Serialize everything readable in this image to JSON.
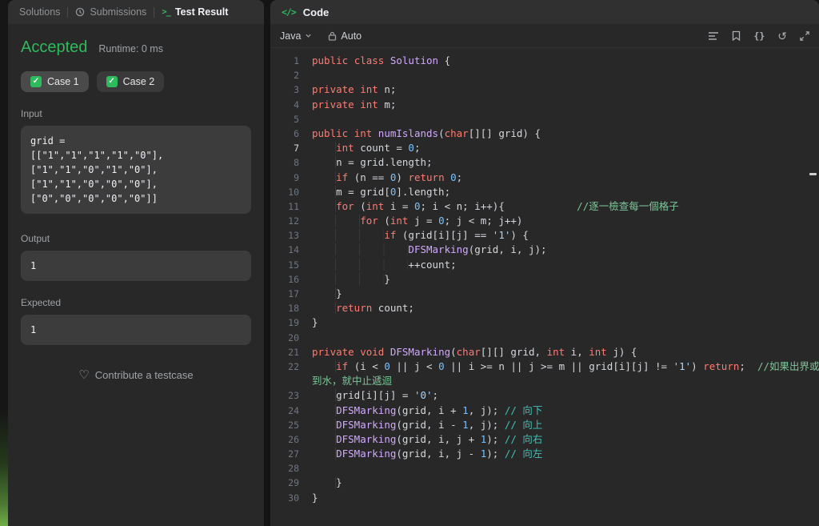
{
  "colors": {
    "accent_green": "#2cbb5d",
    "panel_bg": "#282828",
    "header_bg": "#303030",
    "box_bg": "#3c3c3c",
    "keyword": "#ff7b72",
    "function_name": "#d2a8ff",
    "number": "#79c0ff",
    "string": "#a5d6ff",
    "comment_green": "#7ec699",
    "comment_teal": "#43bfb4"
  },
  "icons": {
    "terminal": ">_",
    "code": "</>",
    "check": "✓",
    "heart": "♡",
    "undo": "↺",
    "braces": "{}"
  },
  "left_panel": {
    "tabs": [
      {
        "label": "Solutions"
      },
      {
        "label": "Submissions"
      },
      {
        "label": "Test Result"
      }
    ],
    "status": "Accepted",
    "runtime": "Runtime: 0 ms",
    "cases": [
      {
        "label": "Case 1"
      },
      {
        "label": "Case 2"
      }
    ],
    "input_label": "Input",
    "input_value": "grid =\n[[\"1\",\"1\",\"1\",\"1\",\"0\"],[\"1\",\"1\",\"0\",\"1\",\"0\"],[\"1\",\"1\",\"0\",\"0\",\"0\"],[\"0\",\"0\",\"0\",\"0\",\"0\"]]",
    "output_label": "Output",
    "output_value": "1",
    "expected_label": "Expected",
    "expected_value": "1",
    "contribute": "Contribute a testcase"
  },
  "editor": {
    "header_title": "Code",
    "language": "Java",
    "auto_label": "Auto",
    "toolbar_icons": [
      "format-icon",
      "bookmark-icon",
      "braces-icon",
      "undo-icon",
      "expand-icon"
    ],
    "lines": [
      {
        "n": "1",
        "tk": [
          [
            "public",
            "k"
          ],
          [
            " ",
            "d"
          ],
          [
            "class",
            "k"
          ],
          [
            " ",
            "d"
          ],
          [
            "Solution",
            "f"
          ],
          [
            " {",
            "d"
          ]
        ]
      },
      {
        "n": "2",
        "tk": []
      },
      {
        "n": "3",
        "tk": [
          [
            "private",
            "k"
          ],
          [
            " ",
            "d"
          ],
          [
            "int",
            "k"
          ],
          [
            " n;",
            "d"
          ]
        ]
      },
      {
        "n": "4",
        "tk": [
          [
            "private",
            "k"
          ],
          [
            " ",
            "d"
          ],
          [
            "int",
            "k"
          ],
          [
            " m;",
            "d"
          ]
        ]
      },
      {
        "n": "5",
        "tk": []
      },
      {
        "n": "6",
        "tk": [
          [
            "public",
            "k"
          ],
          [
            " ",
            "d"
          ],
          [
            "int",
            "k"
          ],
          [
            " ",
            "d"
          ],
          [
            "numIslands",
            "f"
          ],
          [
            "(",
            "d"
          ],
          [
            "char",
            "k"
          ],
          [
            "[][] grid) {",
            "d"
          ]
        ]
      },
      {
        "n": "7",
        "active": true,
        "tk": [
          [
            "    ",
            "i"
          ],
          [
            "int",
            "k"
          ],
          [
            " count = ",
            "d"
          ],
          [
            "0",
            "n"
          ],
          [
            ";",
            "d"
          ]
        ]
      },
      {
        "n": "8",
        "tk": [
          [
            "    ",
            "i"
          ],
          [
            "n = grid.length;",
            "d"
          ]
        ]
      },
      {
        "n": "9",
        "tk": [
          [
            "    ",
            "i"
          ],
          [
            "if",
            "k"
          ],
          [
            " (n == ",
            "d"
          ],
          [
            "0",
            "n"
          ],
          [
            ") ",
            "d"
          ],
          [
            "return",
            "k"
          ],
          [
            " ",
            "d"
          ],
          [
            "0",
            "n"
          ],
          [
            ";",
            "d"
          ]
        ]
      },
      {
        "n": "10",
        "tk": [
          [
            "    ",
            "i"
          ],
          [
            "m = grid[",
            "d"
          ],
          [
            "0",
            "n"
          ],
          [
            "].length;",
            "d"
          ]
        ]
      },
      {
        "n": "11",
        "tk": [
          [
            "    ",
            "i"
          ],
          [
            "for",
            "k"
          ],
          [
            " (",
            "d"
          ],
          [
            "int",
            "k"
          ],
          [
            " i = ",
            "d"
          ],
          [
            "0",
            "n"
          ],
          [
            "; i < n; i++){",
            "d"
          ],
          [
            "            ",
            "d"
          ],
          [
            "//逐一檢查每一個格子",
            "c"
          ]
        ]
      },
      {
        "n": "12",
        "tk": [
          [
            "        ",
            "i"
          ],
          [
            "for",
            "k"
          ],
          [
            " (",
            "d"
          ],
          [
            "int",
            "k"
          ],
          [
            " j = ",
            "d"
          ],
          [
            "0",
            "n"
          ],
          [
            "; j < m; j++)",
            "d"
          ]
        ]
      },
      {
        "n": "13",
        "tk": [
          [
            "            ",
            "i"
          ],
          [
            "if",
            "k"
          ],
          [
            " (grid[i][j] == ",
            "d"
          ],
          [
            "'1'",
            "s"
          ],
          [
            ") {",
            "d"
          ]
        ]
      },
      {
        "n": "14",
        "tk": [
          [
            "                ",
            "i"
          ],
          [
            "DFSMarking",
            "f"
          ],
          [
            "(grid, i, j);",
            "d"
          ]
        ]
      },
      {
        "n": "15",
        "tk": [
          [
            "                ",
            "i"
          ],
          [
            "++count;",
            "d"
          ]
        ]
      },
      {
        "n": "16",
        "tk": [
          [
            "            ",
            "i"
          ],
          [
            "}",
            "d"
          ]
        ]
      },
      {
        "n": "17",
        "tk": [
          [
            "    ",
            "i"
          ],
          [
            "}",
            "d"
          ]
        ]
      },
      {
        "n": "18",
        "tk": [
          [
            "    ",
            "i"
          ],
          [
            "return",
            "k"
          ],
          [
            " count;",
            "d"
          ]
        ]
      },
      {
        "n": "19",
        "tk": [
          [
            "}",
            "d"
          ]
        ]
      },
      {
        "n": "20",
        "tk": []
      },
      {
        "n": "21",
        "tk": [
          [
            "private",
            "k"
          ],
          [
            " ",
            "d"
          ],
          [
            "void",
            "k"
          ],
          [
            " ",
            "d"
          ],
          [
            "DFSMarking",
            "f"
          ],
          [
            "(",
            "d"
          ],
          [
            "char",
            "k"
          ],
          [
            "[][] grid, ",
            "d"
          ],
          [
            "int",
            "k"
          ],
          [
            " i, ",
            "d"
          ],
          [
            "int",
            "k"
          ],
          [
            " j) {",
            "d"
          ]
        ]
      },
      {
        "n": "22",
        "tk": [
          [
            "    ",
            "i"
          ],
          [
            "if",
            "k"
          ],
          [
            " (i < ",
            "d"
          ],
          [
            "0",
            "n"
          ],
          [
            " || j < ",
            "d"
          ],
          [
            "0",
            "n"
          ],
          [
            " || i >= n || j >= m || grid[i][j] != ",
            "d"
          ],
          [
            "'1'",
            "s"
          ],
          [
            ") ",
            "d"
          ],
          [
            "return",
            "k"
          ],
          [
            ";  ",
            "d"
          ],
          [
            "//如果出界或遇",
            "c"
          ]
        ]
      },
      {
        "n": "",
        "tk": [
          [
            "到水，就中止遞迴",
            "c"
          ]
        ]
      },
      {
        "n": "23",
        "tk": [
          [
            "    ",
            "i"
          ],
          [
            "grid[i][j] = ",
            "d"
          ],
          [
            "'0'",
            "s"
          ],
          [
            ";",
            "d"
          ]
        ]
      },
      {
        "n": "24",
        "tk": [
          [
            "    ",
            "i"
          ],
          [
            "DFSMarking",
            "f"
          ],
          [
            "(grid, i + ",
            "d"
          ],
          [
            "1",
            "n"
          ],
          [
            ", j); ",
            "d"
          ],
          [
            "// 向下",
            "ct"
          ]
        ]
      },
      {
        "n": "25",
        "tk": [
          [
            "    ",
            "i"
          ],
          [
            "DFSMarking",
            "f"
          ],
          [
            "(grid, i - ",
            "d"
          ],
          [
            "1",
            "n"
          ],
          [
            ", j); ",
            "d"
          ],
          [
            "// 向上",
            "ct"
          ]
        ]
      },
      {
        "n": "26",
        "tk": [
          [
            "    ",
            "i"
          ],
          [
            "DFSMarking",
            "f"
          ],
          [
            "(grid, i, j + ",
            "d"
          ],
          [
            "1",
            "n"
          ],
          [
            "); ",
            "d"
          ],
          [
            "// 向右",
            "ct"
          ]
        ]
      },
      {
        "n": "27",
        "tk": [
          [
            "    ",
            "i"
          ],
          [
            "DFSMarking",
            "f"
          ],
          [
            "(grid, i, j - ",
            "d"
          ],
          [
            "1",
            "n"
          ],
          [
            "); ",
            "d"
          ],
          [
            "// 向左",
            "ct"
          ]
        ]
      },
      {
        "n": "28",
        "tk": []
      },
      {
        "n": "29",
        "tk": [
          [
            "    ",
            "i"
          ],
          [
            "}",
            "d"
          ]
        ]
      },
      {
        "n": "30",
        "tk": [
          [
            "}",
            "d"
          ]
        ]
      }
    ]
  }
}
